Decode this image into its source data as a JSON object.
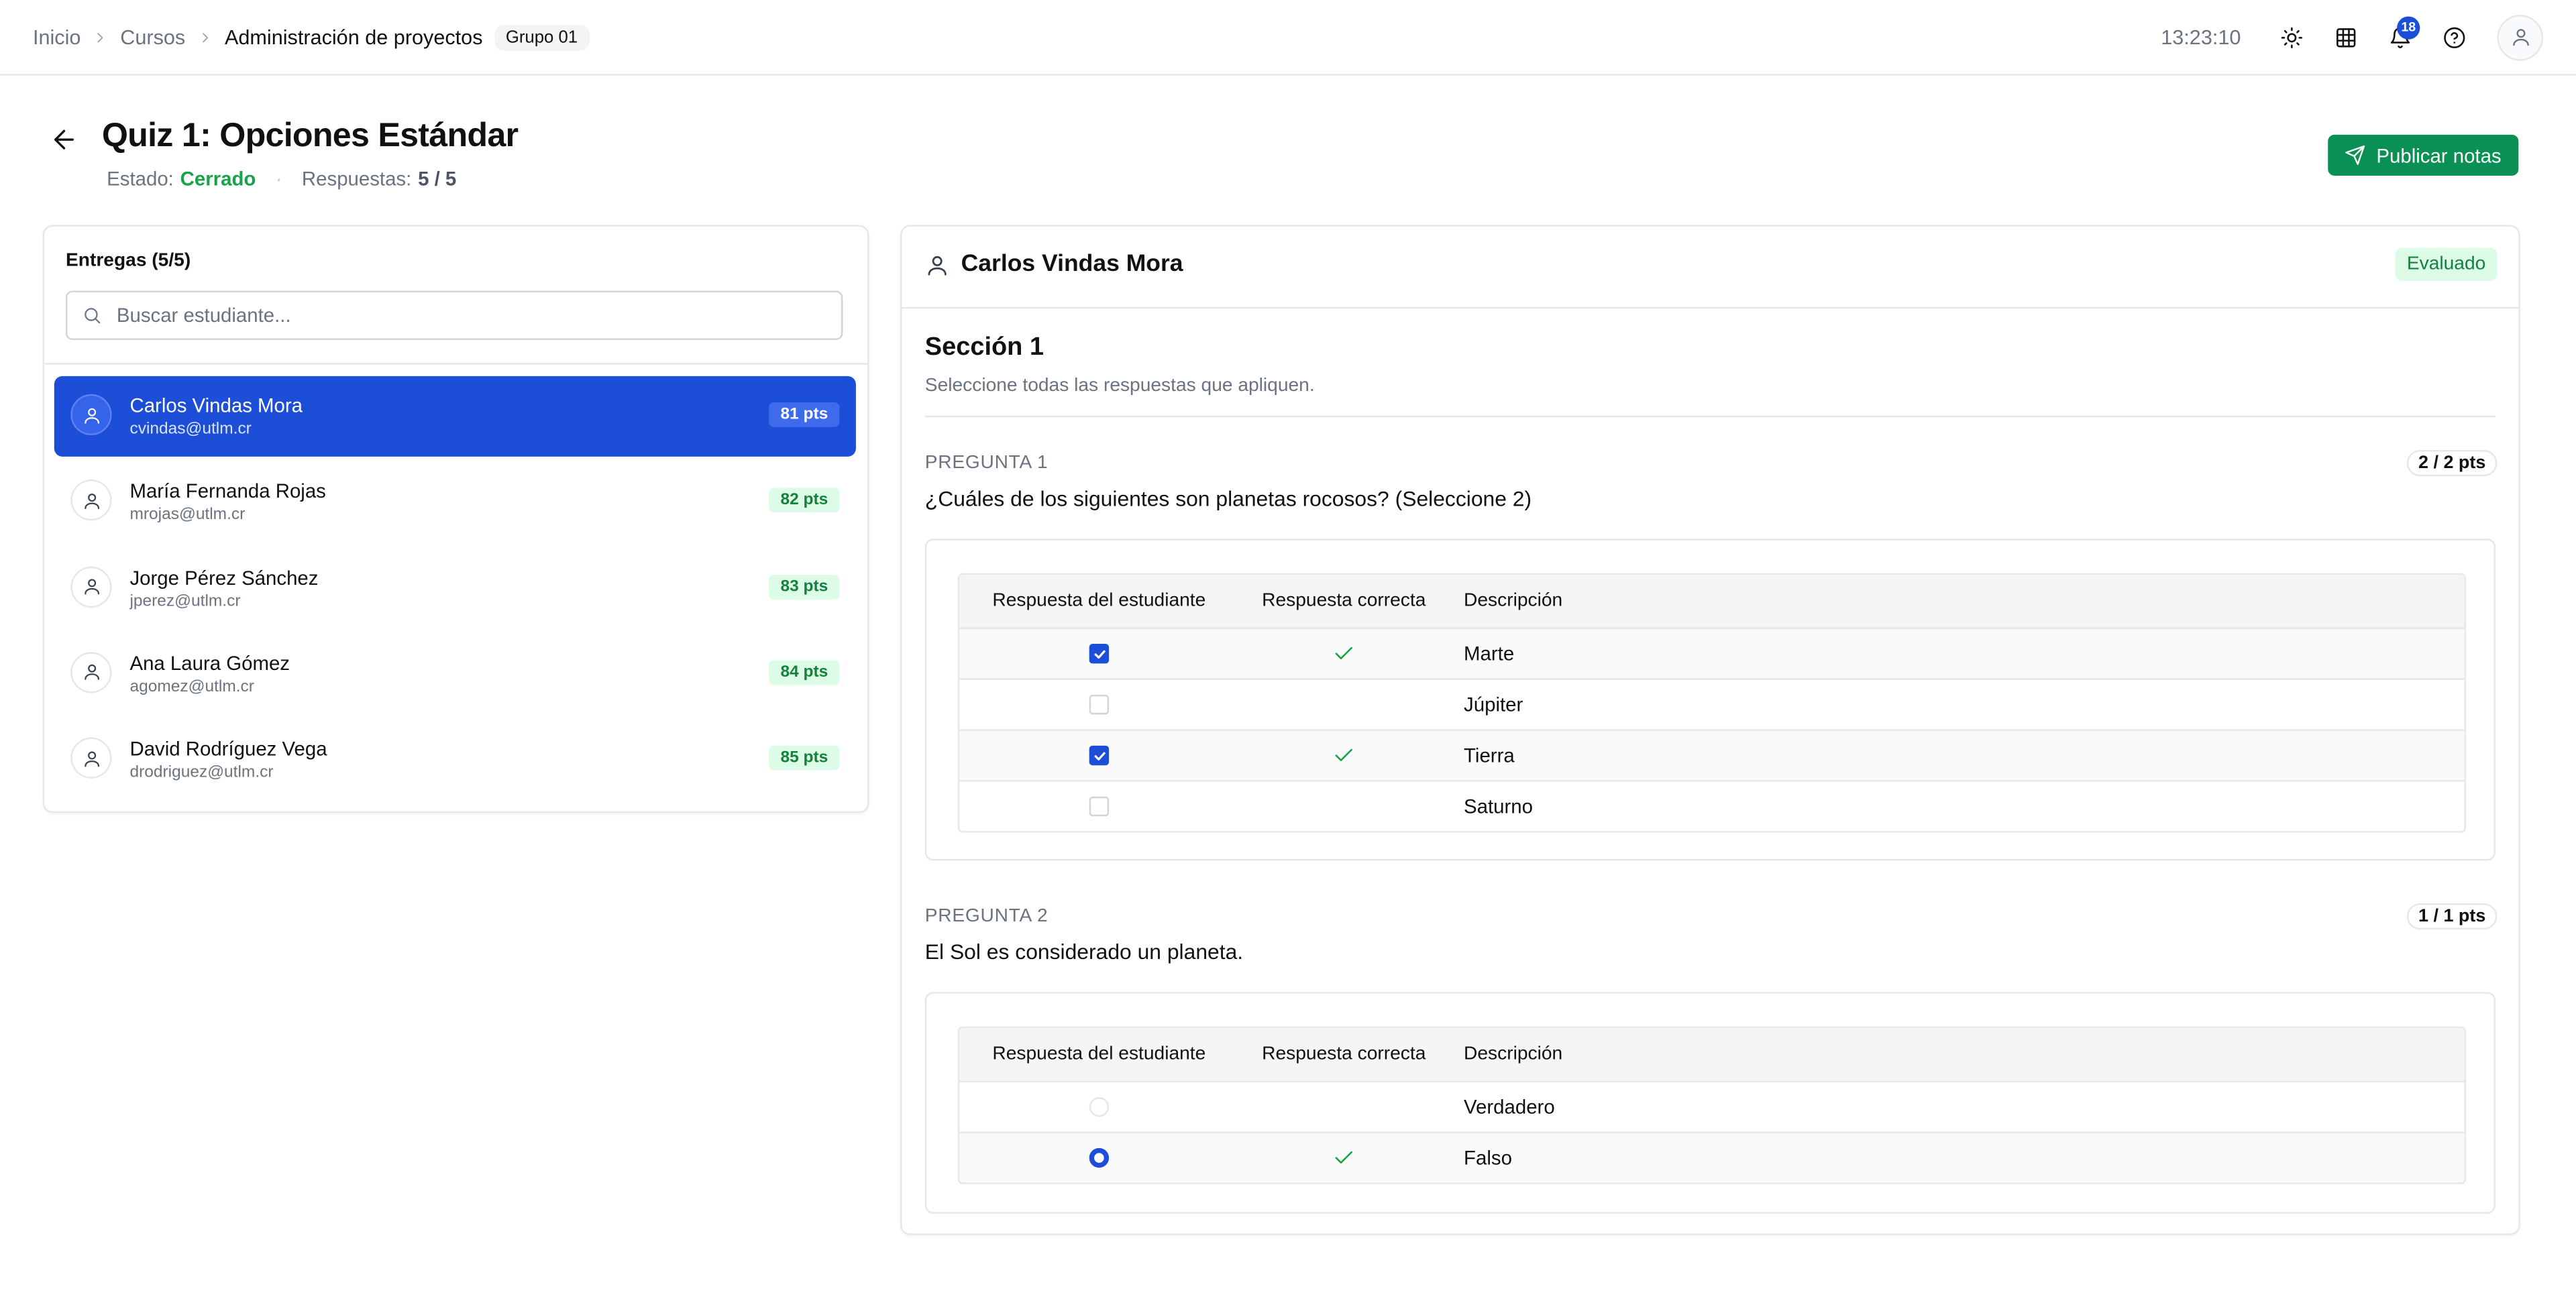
{
  "breadcrumb": {
    "items": [
      "Inicio",
      "Cursos",
      "Administración de proyectos"
    ],
    "badge": "Grupo 01"
  },
  "topbar": {
    "clock": "13:23:10",
    "notification_count": "18",
    "icons": [
      "sun-icon",
      "grid-icon",
      "bell-icon",
      "help-icon",
      "user-icon"
    ]
  },
  "header": {
    "title": "Quiz 1: Opciones Estándar",
    "status_label": "Estado:",
    "status_value": "Cerrado",
    "responses_label": "Respuestas:",
    "responses_value": "5 / 5",
    "publish_label": "Publicar notas"
  },
  "submissions": {
    "title": "Entregas (5/5)",
    "search_placeholder": "Buscar estudiante...",
    "students": [
      {
        "name": "Carlos Vindas Mora",
        "email": "cvindas@utlm.cr",
        "points": "81 pts",
        "selected": true
      },
      {
        "name": "María Fernanda Rojas",
        "email": "mrojas@utlm.cr",
        "points": "82 pts",
        "selected": false
      },
      {
        "name": "Jorge Pérez Sánchez",
        "email": "jperez@utlm.cr",
        "points": "83 pts",
        "selected": false
      },
      {
        "name": "Ana Laura Gómez",
        "email": "agomez@utlm.cr",
        "points": "84 pts",
        "selected": false
      },
      {
        "name": "David Rodríguez Vega",
        "email": "drodriguez@utlm.cr",
        "points": "85 pts",
        "selected": false
      }
    ]
  },
  "detail": {
    "student_name": "Carlos Vindas Mora",
    "status_badge": "Evaluado",
    "section_title": "Sección 1",
    "section_subtitle": "Seleccione todas las respuestas que apliquen.",
    "table_headers": {
      "student_answer": "Respuesta del estudiante",
      "correct_answer": "Respuesta correcta",
      "description": "Descripción"
    },
    "questions": [
      {
        "label": "PREGUNTA 1",
        "points": "2 / 2 pts",
        "text": "¿Cuáles de los siguientes son planetas rocosos? (Seleccione 2)",
        "input_type": "checkbox",
        "options": [
          {
            "description": "Marte",
            "student_selected": true,
            "correct": true
          },
          {
            "description": "Júpiter",
            "student_selected": false,
            "correct": false
          },
          {
            "description": "Tierra",
            "student_selected": true,
            "correct": true
          },
          {
            "description": "Saturno",
            "student_selected": false,
            "correct": false
          }
        ]
      },
      {
        "label": "PREGUNTA 2",
        "points": "1 / 1 pts",
        "text": "El Sol es considerado un planeta.",
        "input_type": "radio",
        "options": [
          {
            "description": "Verdadero",
            "student_selected": false,
            "correct": false
          },
          {
            "description": "Falso",
            "student_selected": true,
            "correct": true
          }
        ]
      }
    ]
  },
  "colors": {
    "accent": "#1d4ed8",
    "publish_button": "#0a8f54",
    "success": "#16a34a",
    "success_bg": "#dcfce7"
  }
}
